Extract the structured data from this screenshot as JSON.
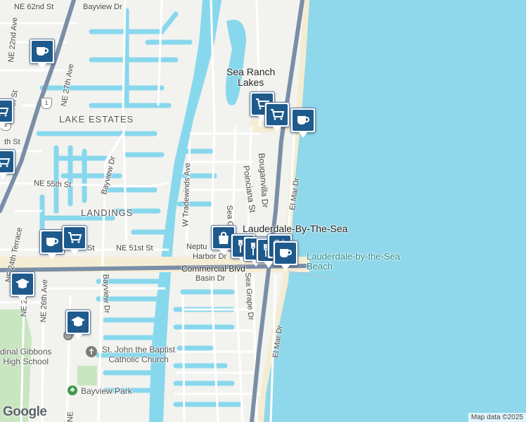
{
  "map": {
    "colors": {
      "land": "#f2f2ef",
      "water": "#88d8ed",
      "ocean": "#8fd7ea",
      "major_road": "#7b8ea7",
      "road": "#ffffff",
      "commercial": "#f6edd5",
      "park": "#c8e6c0",
      "marker_fill": "#1e5a8c"
    },
    "area_labels": [
      {
        "id": "lake-estates",
        "text": "LAKE ESTATES"
      },
      {
        "id": "landings",
        "text": "LANDINGS"
      }
    ],
    "place_labels": [
      {
        "id": "sea-ranch-lakes",
        "text": "Sea Ranch\nLakes"
      },
      {
        "id": "lauderdale-by-the-sea",
        "text": "Lauderdale-By-The-Sea"
      },
      {
        "id": "lauderdale-beach",
        "text": "Lauderdale-by-the-Sea\nBeach"
      },
      {
        "id": "cardinal-gibbons",
        "text": "dinal Gibbons\nHigh School"
      },
      {
        "id": "st-john",
        "text": "St. John the Baptist\nCatholic Church"
      },
      {
        "id": "bayview-park",
        "text": "Bayview Park"
      }
    ],
    "street_labels": [
      {
        "id": "ne-62nd-st",
        "text": "NE 62nd St"
      },
      {
        "id": "bayview-dr-top",
        "text": "Bayview Dr"
      },
      {
        "id": "ne-22nd-ave",
        "text": "NE 22nd Ave"
      },
      {
        "id": "ne-57th-st",
        "text": "NE 57th St"
      },
      {
        "id": "ne-27th-ave",
        "text": "NE 27th Ave"
      },
      {
        "id": "th-st",
        "text": "th St"
      },
      {
        "id": "bayview-dr-mid",
        "text": "Bayview Dr"
      },
      {
        "id": "ne-55th-st",
        "text": "NE 55th St"
      },
      {
        "id": "w-tradewinds-ave",
        "text": "W Tradewinds Ave"
      },
      {
        "id": "sea-grape-dr-top",
        "text": "Sea Grape Dr"
      },
      {
        "id": "poinciana-st",
        "text": "Poinciana St"
      },
      {
        "id": "bouganvilla-dr",
        "text": "Bouganvilla Dr"
      },
      {
        "id": "el-mar-dr-top",
        "text": "El Mar Dr"
      },
      {
        "id": "ne-24th-terrace",
        "text": "NE 24th Terrace"
      },
      {
        "id": "ne-51st-st",
        "text": "NE 51st St"
      },
      {
        "id": "st-fragment",
        "text": "St"
      },
      {
        "id": "neptune",
        "text": "Neptu"
      },
      {
        "id": "harbor-dr",
        "text": "Harbor Dr"
      },
      {
        "id": "commercial-blvd",
        "text": "Commercial Blvd"
      },
      {
        "id": "basin-dr",
        "text": "Basin Dr"
      },
      {
        "id": "sea-grape-dr-bot",
        "text": "Sea Grape Dr"
      },
      {
        "id": "ne-25th",
        "text": "NE 25th"
      },
      {
        "id": "ne-26th-ave",
        "text": "NE 26th Ave"
      },
      {
        "id": "bayview-dr-bot",
        "text": "Bayview Dr"
      },
      {
        "id": "el-mar-dr-bot",
        "text": "El Mar Dr"
      },
      {
        "id": "ne-bottom",
        "text": "NE"
      }
    ],
    "route_shields": [
      "1",
      "1"
    ],
    "markers": [
      {
        "id": "coffee-1",
        "icon": "coffee-cup-icon"
      },
      {
        "id": "cart-1",
        "icon": "shopping-cart-icon"
      },
      {
        "id": "cart-2",
        "icon": "shopping-cart-icon"
      },
      {
        "id": "coffee-2",
        "icon": "coffee-cup-icon"
      },
      {
        "id": "cart-3",
        "icon": "shopping-cart-icon"
      },
      {
        "id": "cart-4",
        "icon": "shopping-cart-icon"
      },
      {
        "id": "coffee-3",
        "icon": "coffee-cup-icon"
      },
      {
        "id": "cart-5",
        "icon": "shopping-cart-icon"
      },
      {
        "id": "bag-1",
        "icon": "shopping-bag-icon"
      },
      {
        "id": "food-1",
        "icon": "fork-knife-icon"
      },
      {
        "id": "food-2",
        "icon": "fork-knife-icon"
      },
      {
        "id": "food-3",
        "icon": "fork-knife-icon"
      },
      {
        "id": "food-4",
        "icon": "fork-knife-icon"
      },
      {
        "id": "coffee-4",
        "icon": "coffee-cup-icon"
      },
      {
        "id": "school-1",
        "icon": "graduation-cap-icon"
      },
      {
        "id": "school-2",
        "icon": "graduation-cap-icon"
      }
    ],
    "brand": "Google",
    "attribution": "Map data ©2025"
  }
}
